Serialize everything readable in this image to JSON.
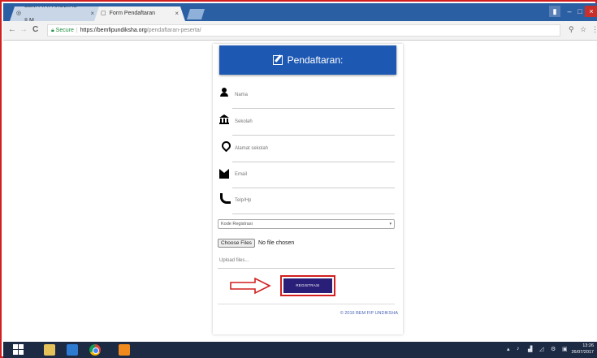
{
  "browser": {
    "tabs": [
      {
        "label": "BEM FIP/FAKULTAS ILM",
        "close": "×"
      },
      {
        "label": "Form Pendaftaran",
        "close": "×"
      }
    ],
    "window_controls": {
      "minimize": "–",
      "maximize": "□",
      "close": "×"
    },
    "address": {
      "secure_label": "Secure",
      "separator": "|",
      "host": "https://bemfipundiksha.org",
      "path": "/pendaftaran-peserta/"
    },
    "nav": {
      "back": "←",
      "forward": "→",
      "reload": "C"
    }
  },
  "form": {
    "title": "Pendaftaran:",
    "fields": [
      {
        "icon": "user-icon",
        "placeholder": "Nama"
      },
      {
        "icon": "bank-icon",
        "placeholder": "Sekolah"
      },
      {
        "icon": "map-marker-icon",
        "placeholder": "Alamat sekolah"
      },
      {
        "icon": "envelope-icon",
        "placeholder": "Email"
      },
      {
        "icon": "phone-icon",
        "placeholder": "Telp/Hp"
      }
    ],
    "select_value": "Kode Registrasi",
    "file_button": "Choose Files",
    "file_status": "No file chosen",
    "upload_label": "Upload files...",
    "register_button": "REGISTRASI",
    "footer": "© 2016 BEM FIP UNDIKSHA"
  },
  "taskbar": {
    "time": "13:26",
    "date": "26/07/2017"
  },
  "colors": {
    "header_blue": "#1d58b3",
    "button_navy": "#2a1f78",
    "highlight_red": "#d21f1f"
  }
}
